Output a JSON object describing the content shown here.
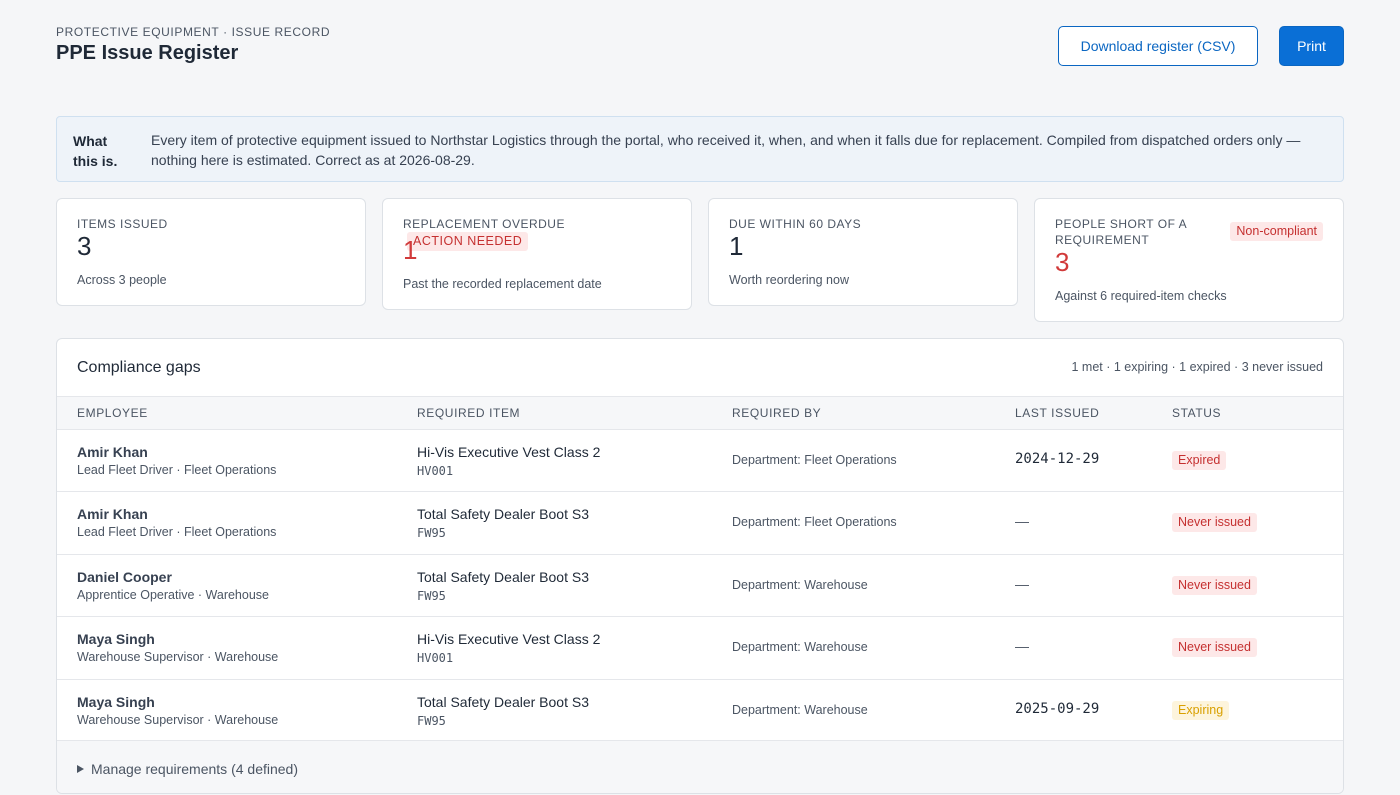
{
  "header": {
    "eyebrow": "PROTECTIVE EQUIPMENT · ISSUE RECORD",
    "title": "PPE Issue Register",
    "download_label": "Download register (CSV)",
    "print_label": "Print"
  },
  "info": {
    "label": "What this is.",
    "text": "Every item of protective equipment issued to Northstar Logistics through the portal, who received it, when, and when it falls due for replacement. Compiled from dispatched orders only — nothing here is estimated. Correct as at 2026-08-29."
  },
  "stats": [
    {
      "label": "ITEMS ISSUED",
      "value": "3",
      "sub": "Across 3 people",
      "badge": ""
    },
    {
      "label": "REPLACEMENT OVERDUE",
      "value": "1",
      "sub": "Past the recorded replacement date",
      "badge": "Action needed"
    },
    {
      "label": "DUE WITHIN 60 DAYS",
      "value": "1",
      "sub": "Worth reordering now",
      "badge": ""
    },
    {
      "label": "PEOPLE SHORT OF A REQUIREMENT",
      "value": "3",
      "sub": "Against 6 required-item checks",
      "badge": "Non-compliant"
    }
  ],
  "compliance": {
    "title": "Compliance gaps",
    "summary": "1 met · 1 expiring · 1 expired · 3 never issued",
    "columns": [
      "EMPLOYEE",
      "REQUIRED ITEM",
      "REQUIRED BY",
      "LAST ISSUED",
      "STATUS"
    ],
    "rows": [
      {
        "name": "Amir Khan",
        "role": "Lead Fleet Driver · Fleet Operations",
        "item": "Hi-Vis Executive Vest Class 2",
        "code": "HV001",
        "required_by": "Department: Fleet Operations",
        "last_issued": "2024-12-29",
        "status": "Expired"
      },
      {
        "name": "Amir Khan",
        "role": "Lead Fleet Driver · Fleet Operations",
        "item": "Total Safety Dealer Boot S3",
        "code": "FW95",
        "required_by": "Department: Fleet Operations",
        "last_issued": "—",
        "status": "Never issued"
      },
      {
        "name": "Daniel Cooper",
        "role": "Apprentice Operative · Warehouse",
        "item": "Total Safety Dealer Boot S3",
        "code": "FW95",
        "required_by": "Department: Warehouse",
        "last_issued": "—",
        "status": "Never issued"
      },
      {
        "name": "Maya Singh",
        "role": "Warehouse Supervisor · Warehouse",
        "item": "Hi-Vis Executive Vest Class 2",
        "code": "HV001",
        "required_by": "Department: Warehouse",
        "last_issued": "—",
        "status": "Never issued"
      },
      {
        "name": "Maya Singh",
        "role": "Warehouse Supervisor · Warehouse",
        "item": "Total Safety Dealer Boot S3",
        "code": "FW95",
        "required_by": "Department: Warehouse",
        "last_issued": "2025-09-29",
        "status": "Expiring"
      }
    ],
    "manage_label": "Manage requirements (4 defined)"
  },
  "colors": {
    "accent": "#0a6fd6",
    "danger": "#c53030",
    "warning": "#d9a000"
  }
}
